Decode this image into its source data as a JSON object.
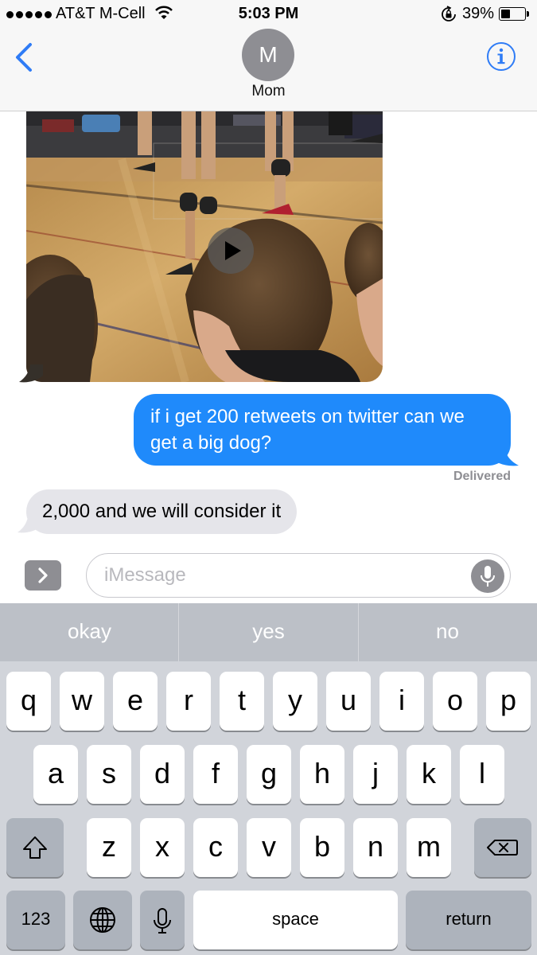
{
  "status_bar": {
    "carrier": "AT&T M-Cell",
    "time": "5:03 PM",
    "battery": "39%",
    "battery_level": 0.39
  },
  "header": {
    "avatar_initial": "M",
    "contact_name": "Mom"
  },
  "messages": {
    "outgoing_text": "if i get 200 retweets on twitter can we get a big dog?",
    "delivered_label": "Delivered",
    "incoming_text": "2,000 and we will consider it"
  },
  "composer": {
    "placeholder": "iMessage"
  },
  "keyboard": {
    "suggestions": [
      "okay",
      "yes",
      "no"
    ],
    "row1": [
      "q",
      "w",
      "e",
      "r",
      "t",
      "y",
      "u",
      "i",
      "o",
      "p"
    ],
    "row2": [
      "a",
      "s",
      "d",
      "f",
      "g",
      "h",
      "j",
      "k",
      "l"
    ],
    "row3": [
      "z",
      "x",
      "c",
      "v",
      "b",
      "n",
      "m"
    ],
    "numbers_label": "123",
    "space_label": "space",
    "return_label": "return"
  },
  "colors": {
    "imessage_blue": "#1f8afb",
    "ios_blue": "#2f7cf6",
    "incoming_gray": "#e5e5ea"
  }
}
